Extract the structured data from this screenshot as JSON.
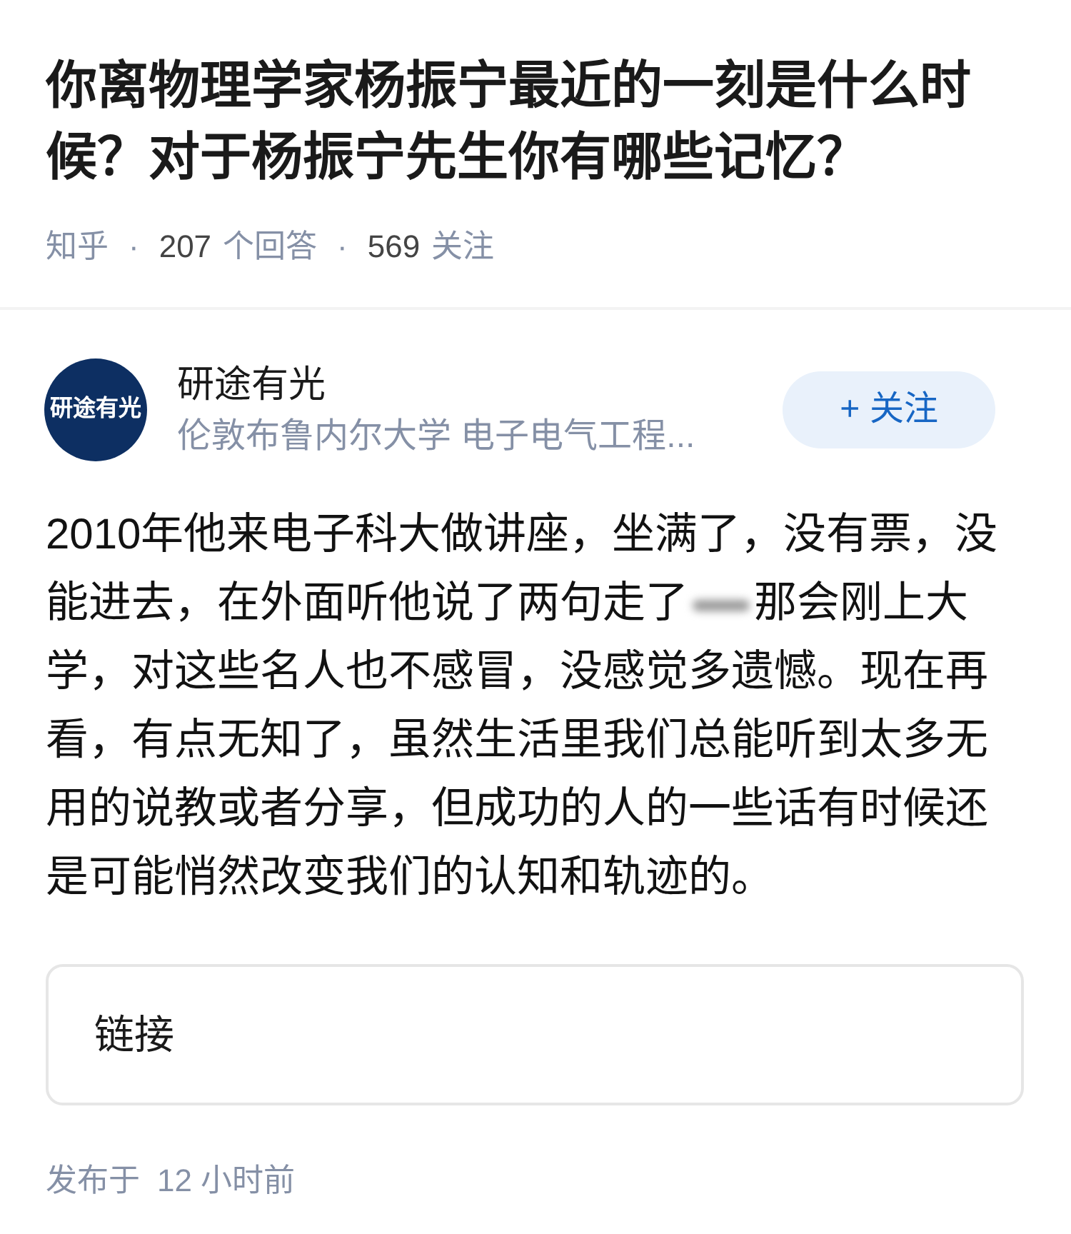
{
  "question": {
    "title": "你离物理学家杨振宁最近的一刻是什么时候？对于杨振宁先生你有哪些记忆？",
    "meta": [
      {
        "kind": "source",
        "text": "知乎"
      },
      {
        "kind": "separator",
        "text": "·"
      },
      {
        "kind": "count",
        "text": "207"
      },
      {
        "kind": "label",
        "text": "个回答"
      },
      {
        "kind": "separator",
        "text": "·"
      },
      {
        "kind": "count",
        "text": "569"
      },
      {
        "kind": "label",
        "text": "关注"
      }
    ]
  },
  "author": {
    "avatar_text": "研途有光",
    "name": "研途有光",
    "description": "伦敦布鲁内尔大学 电子电气工程...",
    "follow_button": {
      "label": "+ 关注",
      "followed": false
    }
  },
  "answer": {
    "text_before": "2010年他来电子科大做讲座，坐满了，没有票，没能进去，在外面听他说了两句走了",
    "text_after": "那会刚上大学，对这些名人也不感冒，没感觉多遗憾。现在再看，有点无知了，虽然生活里我们总能听到太多无用的说教或者分享，但成功的人的一些话有时候还是可能悄然改变我们的认知和轨迹的。"
  },
  "link_card": {
    "label": "链接"
  },
  "footer": {
    "published_label": "发布于",
    "time": "12 小时前"
  }
}
